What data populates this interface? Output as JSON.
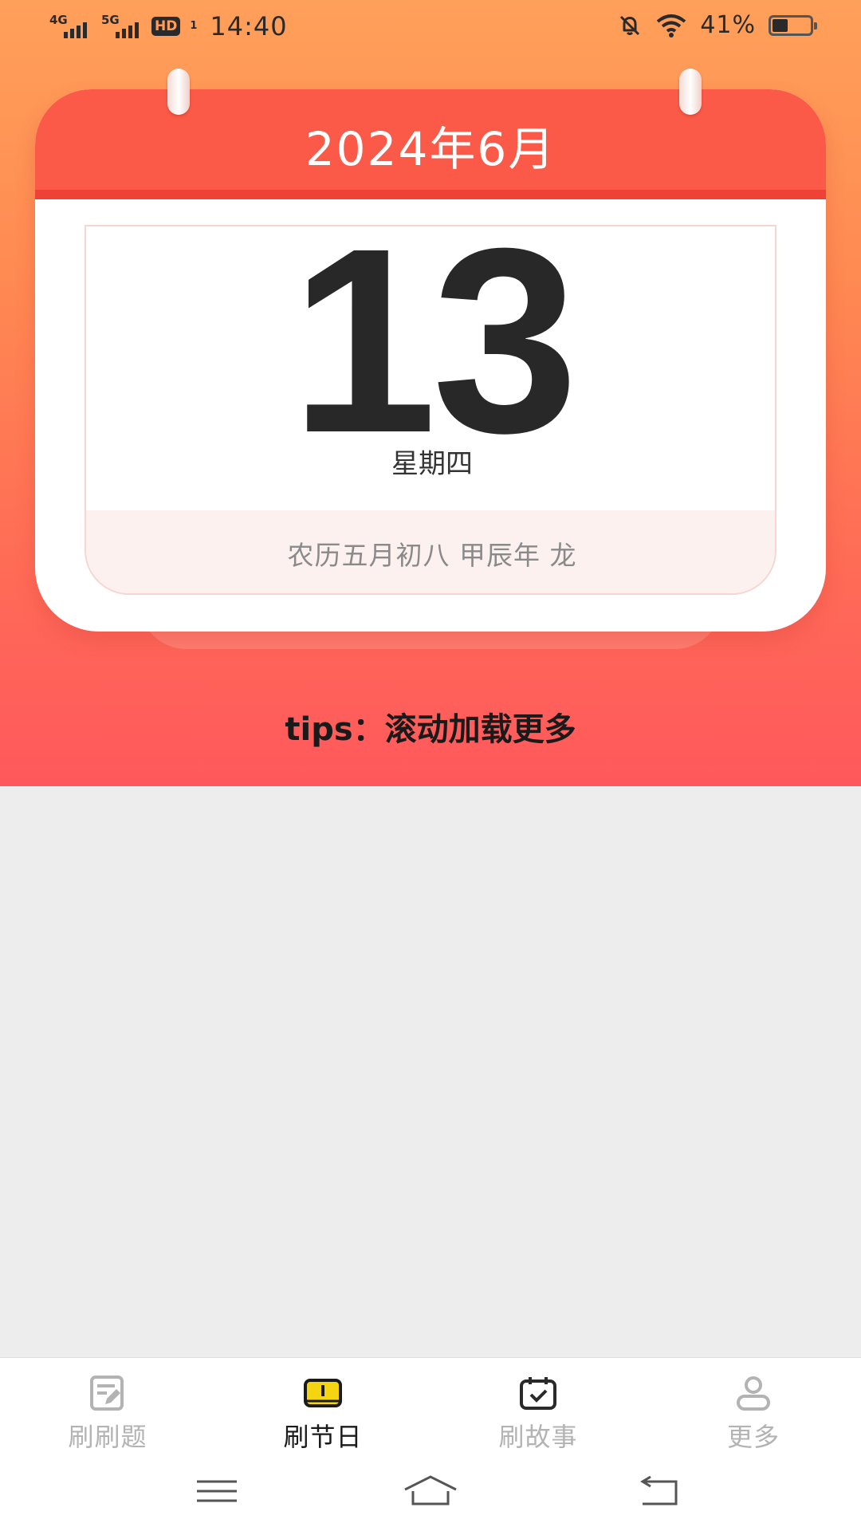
{
  "status_bar": {
    "net1": "4G",
    "net2": "5G",
    "hd": "HD",
    "hd_sub": "1",
    "time": "14:40",
    "battery_pct": "41%",
    "battery_level": 0.41,
    "icons": [
      "mute-bell-icon",
      "wifi-icon",
      "battery-icon"
    ]
  },
  "calendar": {
    "month_title": "2024年6月",
    "day": "13",
    "weekday": "星期四",
    "lunar": "农历五月初八 甲辰年 龙",
    "header_color": "#fb5a48"
  },
  "tips": "tips：滚动加载更多",
  "tabs": [
    {
      "label": "刷刷题",
      "icon": "edit-note-icon",
      "active": false
    },
    {
      "label": "刷节日",
      "icon": "holiday-icon",
      "active": true
    },
    {
      "label": "刷故事",
      "icon": "calendar-check-icon",
      "active": false
    },
    {
      "label": "更多",
      "icon": "user-icon",
      "active": false
    }
  ],
  "colors": {
    "accent": "#f5d411",
    "gradient_top": "#ffa05a",
    "gradient_bottom": "#ff585c"
  }
}
